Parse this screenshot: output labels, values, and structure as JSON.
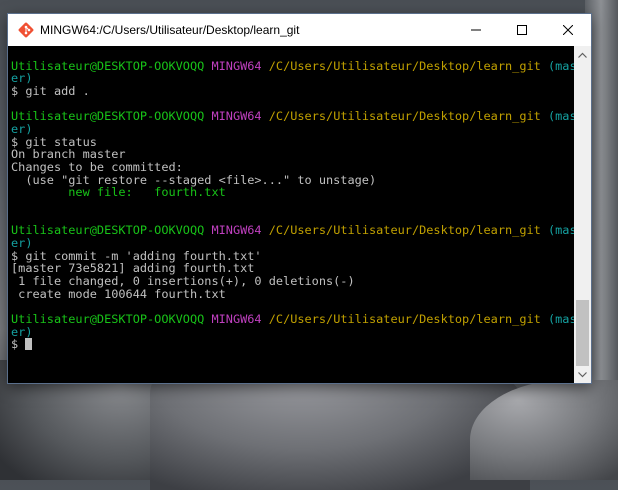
{
  "window": {
    "title": "MINGW64:/C/Users/Utilisateur/Desktop/learn_git",
    "icons": {
      "app": "git-bash-icon",
      "minimize": "minimize-icon",
      "maximize": "maximize-icon",
      "close": "close-icon"
    }
  },
  "terminal": {
    "blocks": [
      {
        "user": "Utilisateur@DESKTOP-OOKVOQQ",
        "env": "MINGW64",
        "path": "/C/Users/Utilisateur/Desktop/learn_git",
        "branch_a": "(mast",
        "branch_b": "er)",
        "command": "$ git add .",
        "output": []
      },
      {
        "user": "Utilisateur@DESKTOP-OOKVOQQ",
        "env": "MINGW64",
        "path": "/C/Users/Utilisateur/Desktop/learn_git",
        "branch_a": "(mast",
        "branch_b": "er)",
        "command": "$ git status",
        "output": [
          "On branch master",
          "Changes to be committed:",
          "  (use \"git restore --staged <file>...\" to unstage)"
        ],
        "staged": "        new file:   fourth.txt"
      },
      {
        "user": "Utilisateur@DESKTOP-OOKVOQQ",
        "env": "MINGW64",
        "path": "/C/Users/Utilisateur/Desktop/learn_git",
        "branch_a": "(mast",
        "branch_b": "er)",
        "command": "$ git commit -m 'adding fourth.txt'",
        "output": [
          "[master 73e5821] adding fourth.txt",
          " 1 file changed, 0 insertions(+), 0 deletions(-)",
          " create mode 100644 fourth.txt"
        ]
      },
      {
        "user": "Utilisateur@DESKTOP-OOKVOQQ",
        "env": "MINGW64",
        "path": "/C/Users/Utilisateur/Desktop/learn_git",
        "branch_a": "(mast",
        "branch_b": "er)",
        "command": "$ ",
        "output": []
      }
    ]
  },
  "colors": {
    "user": "#18c318",
    "env": "#c040c0",
    "path": "#c0a000",
    "branch": "#15a1a1",
    "text": "#c0c0c0",
    "background": "#000000"
  }
}
